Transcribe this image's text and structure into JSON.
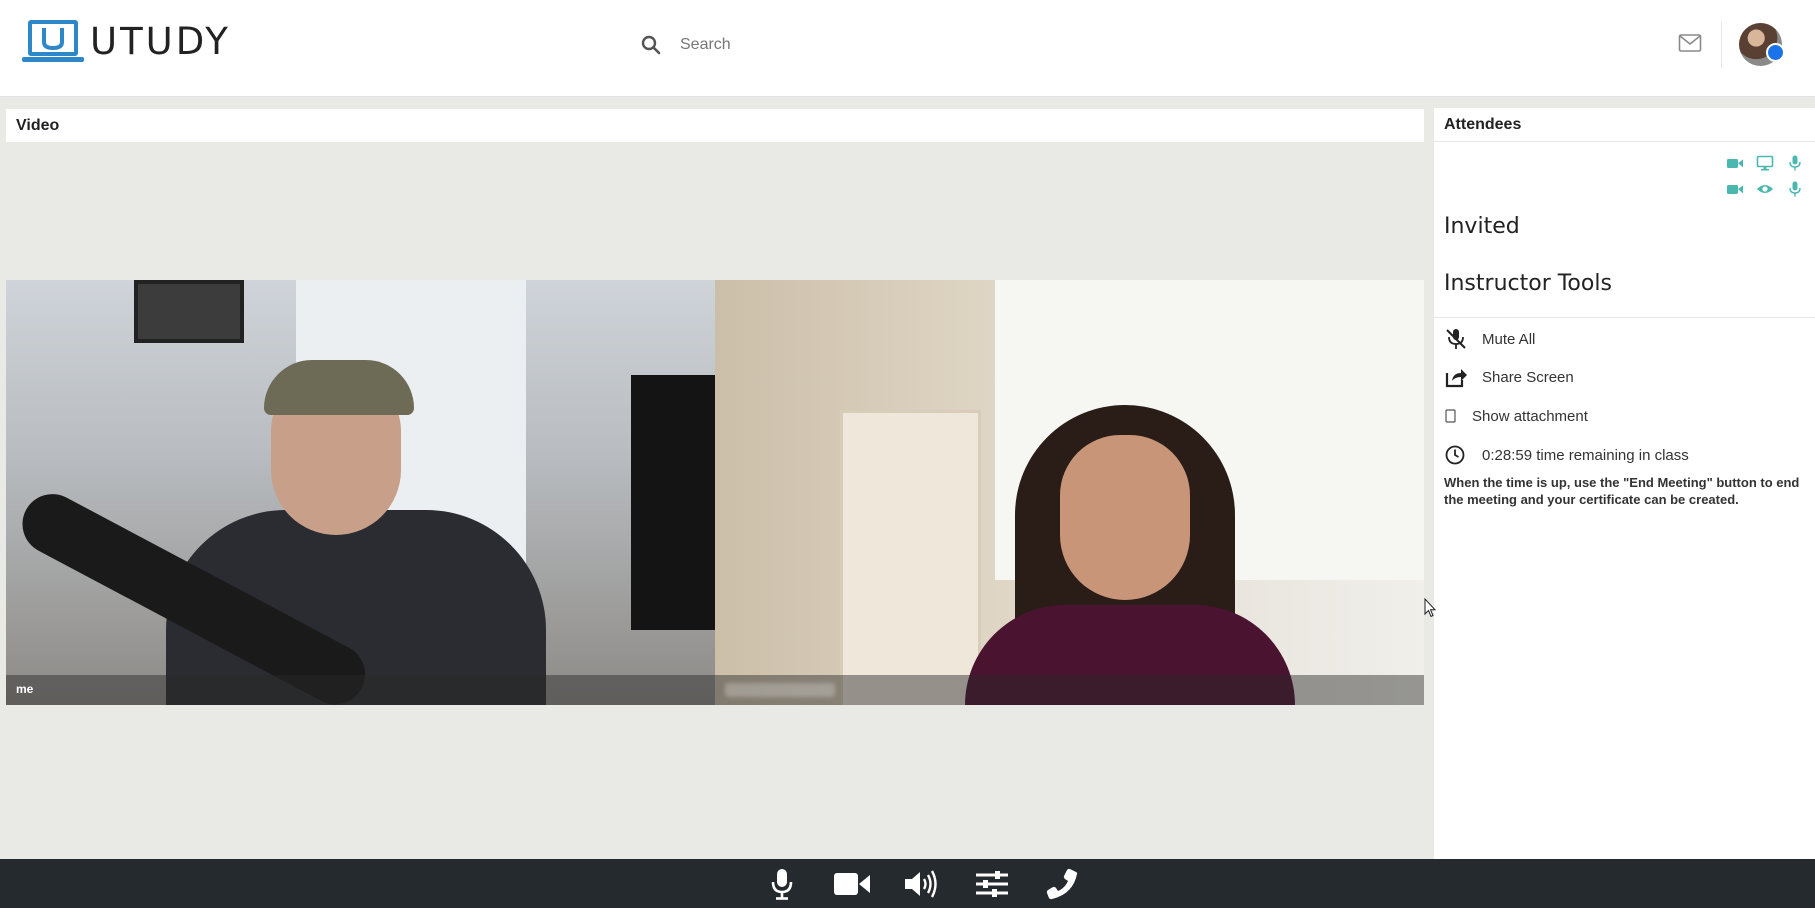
{
  "header": {
    "logo_text": "UTUDY",
    "search_placeholder": "Search"
  },
  "video": {
    "title": "Video",
    "tiles": [
      {
        "caption": "me"
      },
      {
        "caption": ""
      }
    ]
  },
  "attendees": {
    "title": "Attendees",
    "status_icons_row1": [
      "video-camera-icon",
      "monitor-icon",
      "microphone-icon"
    ],
    "status_icons_row2": [
      "video-camera-icon",
      "eye-icon",
      "microphone-icon"
    ],
    "invited_heading": "Invited",
    "instructor_tools_heading": "Instructor Tools",
    "tools": {
      "mute_all": "Mute All",
      "share_screen": "Share Screen",
      "show_attachment": "Show attachment",
      "time_remaining": "0:28:59 time remaining in class"
    },
    "note": "When the time is up, use the \"End Meeting\" button to end the meeting and your certificate can be created."
  },
  "controls": [
    "microphone-icon",
    "video-camera-icon",
    "speaker-icon",
    "settings-sliders-icon",
    "end-call-icon"
  ],
  "colors": {
    "accent_teal": "#4bb8b0",
    "logo_blue": "#2c88c9",
    "control_bar": "#252a2e"
  }
}
